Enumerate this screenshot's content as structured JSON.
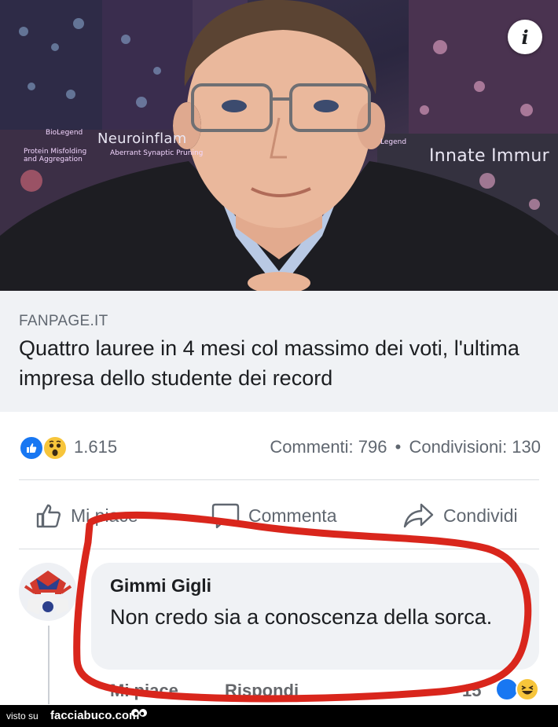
{
  "hero": {
    "info_glyph": "i",
    "poster_texts": {
      "neuro": "Neuroinflam",
      "innate": "Innate Immur",
      "biolegend_left": "BioLegend",
      "biolegend_right": "Legend",
      "protein": "Protein Misfolding and Aggregation",
      "aberrant": "Aberrant Synaptic Pruning"
    }
  },
  "link": {
    "source": "FANPAGE.IT",
    "title": "Quattro lauree in 4 mesi col massimo dei voti, l'ultima impresa dello studente dei record"
  },
  "reactions": {
    "count": "1.615",
    "comments": "Commenti: 796",
    "separator": "•",
    "shares": "Condivisioni: 130",
    "icons": [
      "like-icon",
      "wow-icon"
    ]
  },
  "actions": {
    "like": "Mi piace",
    "comment": "Commenta",
    "share": "Condividi"
  },
  "comment": {
    "author": "Gimmi Gigli",
    "text": "Non credo sia a conoscenza della sorca.",
    "like_label": "Mi piace",
    "reply_label": "Rispondi",
    "time": "15"
  },
  "footer": {
    "visto_su": "visto su",
    "site": "facciabuco.com"
  },
  "colors": {
    "facebook_blue": "#1877f2",
    "wow_yellow": "#f7c53b",
    "red_mark": "#d9261c",
    "muted_text": "#606770"
  }
}
